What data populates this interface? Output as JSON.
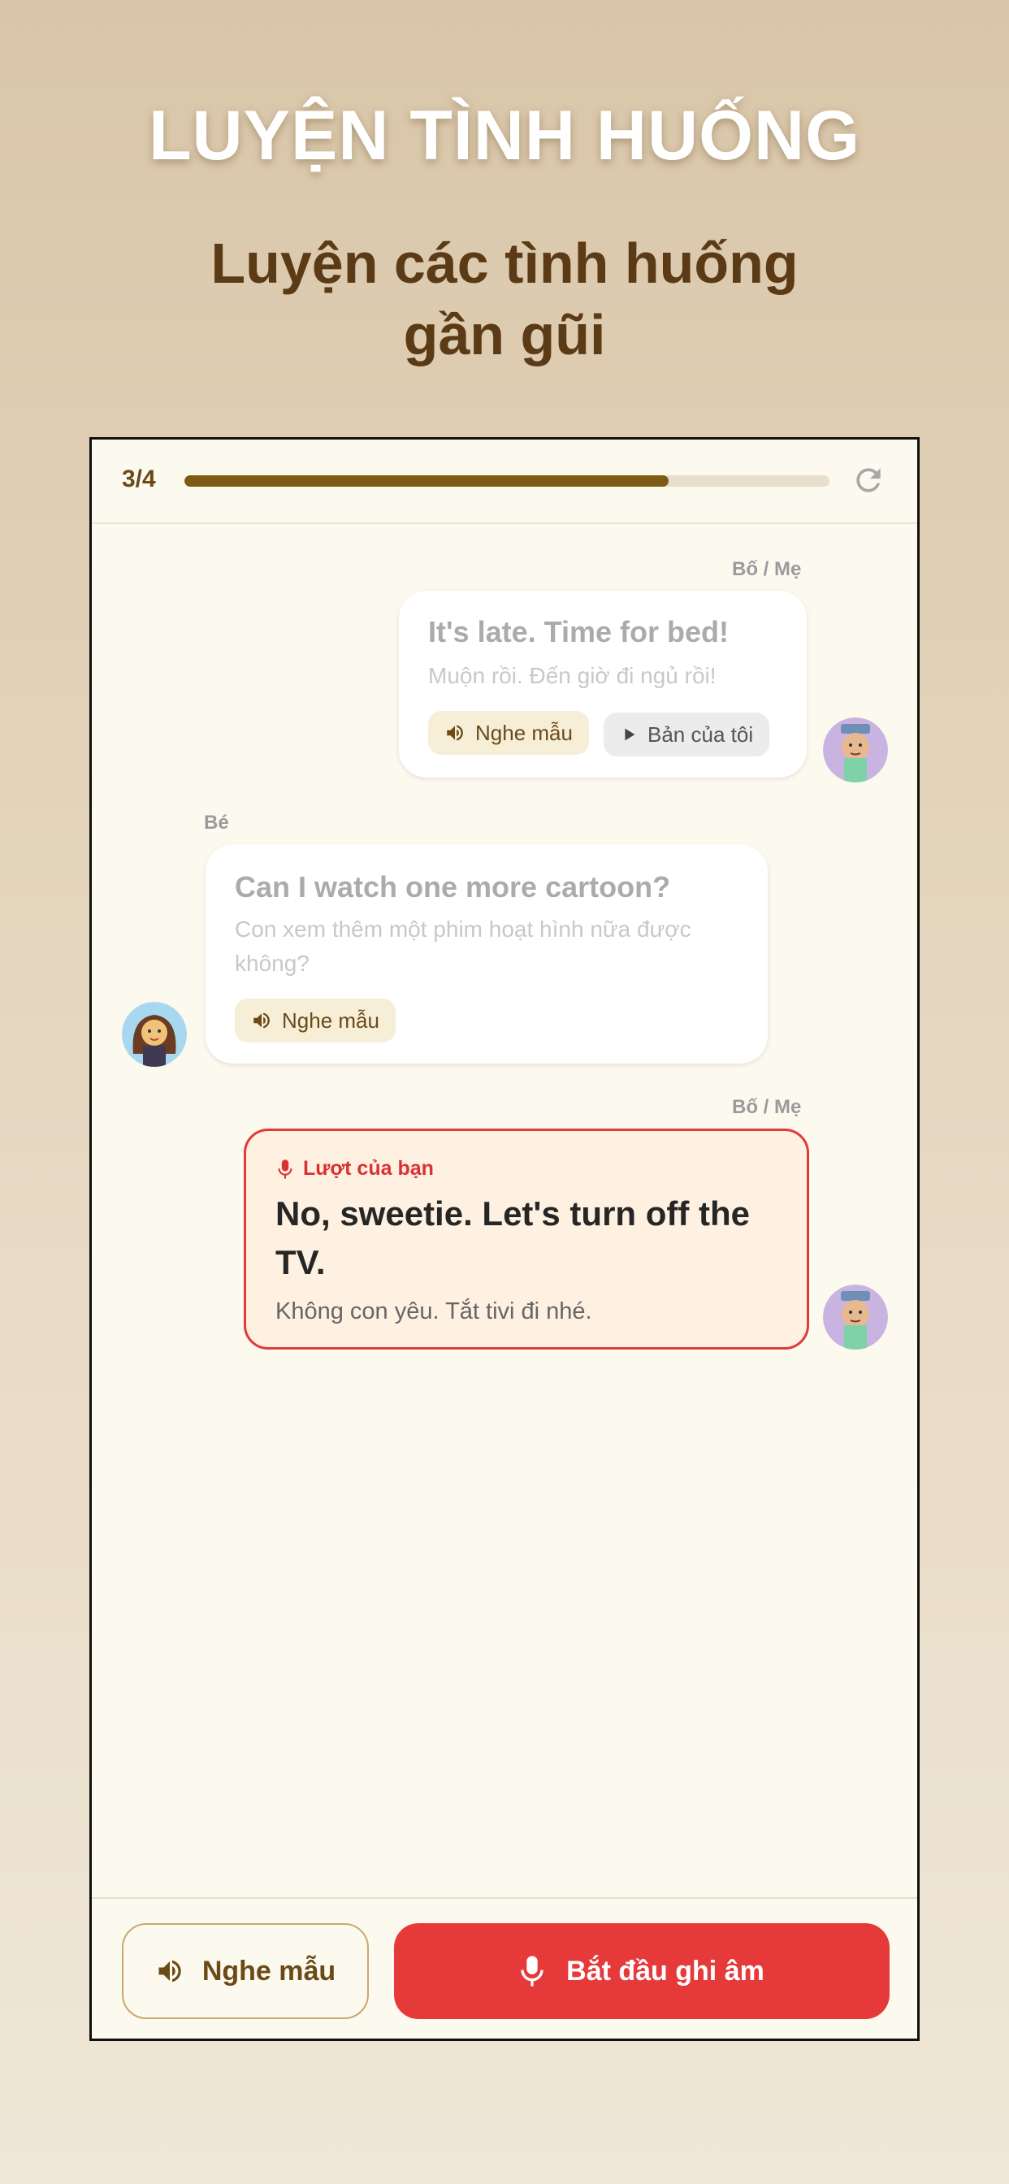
{
  "hero": {
    "title": "LUYỆN TÌNH HUỐNG",
    "subtitle_line1": "Luyện các tình huống",
    "subtitle_line2": "gần gũi"
  },
  "header": {
    "step": "3/4",
    "progress_fraction": 0.75,
    "refresh_icon": "refresh-icon"
  },
  "conversation": [
    {
      "speaker": "Bố / Mẹ",
      "english": "It's late. Time for bed!",
      "vietnamese": "Muộn rồi. Đến giờ đi ngủ rồi!",
      "listen_label": "Nghe mẫu",
      "mine_label": "Bản của tôi"
    },
    {
      "speaker": "Bé",
      "english": "Can I watch one more cartoon?",
      "vietnamese": "Con xem thêm một phim hoạt hình nữa được không?",
      "listen_label": "Nghe mẫu"
    },
    {
      "speaker": "Bố / Mẹ",
      "turn_label": "Lượt của bạn",
      "english": "No, sweetie. Let's turn off the TV.",
      "vietnamese": "Không con yêu. Tắt tivi đi nhé."
    }
  ],
  "footer": {
    "listen_label": "Nghe mẫu",
    "record_label": "Bắt đầu ghi âm"
  },
  "colors": {
    "accent_brown": "#7d5b12",
    "record_red": "#e63a3a",
    "turn_border": "#e03a3a"
  }
}
